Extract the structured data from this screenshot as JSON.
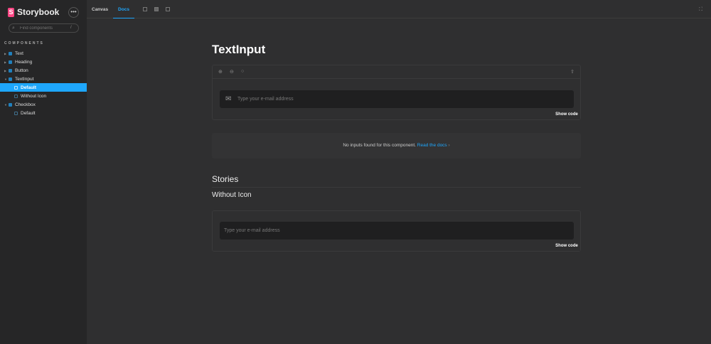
{
  "sidebar": {
    "brand": "Storybook",
    "logo_letter": "S",
    "more": "•••",
    "search_placeholder": "Find components",
    "search_shortcut": "/",
    "section": "COMPONENTS",
    "items": [
      {
        "label": "Text",
        "type": "component"
      },
      {
        "label": "Heading",
        "type": "component"
      },
      {
        "label": "Button",
        "type": "component"
      },
      {
        "label": "TextInput",
        "type": "component",
        "expanded": true
      },
      {
        "label": "Default",
        "type": "story",
        "selected": true
      },
      {
        "label": "Without Icon",
        "type": "story"
      },
      {
        "label": "Checkbox",
        "type": "component",
        "expanded": true
      },
      {
        "label": "Default",
        "type": "story"
      }
    ]
  },
  "toolbar": {
    "tabs": [
      "Canvas",
      "Docs"
    ],
    "active_tab": "Docs"
  },
  "docs": {
    "title": "TextInput",
    "primary": {
      "placeholder": "Type your e-mail address",
      "show_code": "Show code"
    },
    "args": {
      "text": "No inputs found for this component.",
      "link": "Read the docs",
      "chevron": "›"
    },
    "stories_heading": "Stories",
    "story": {
      "title": "Without Icon",
      "placeholder": "Type your e-mail address",
      "show_code": "Show code"
    }
  },
  "colors": {
    "accent": "#1ea7fd",
    "brand": "#ff4785"
  }
}
